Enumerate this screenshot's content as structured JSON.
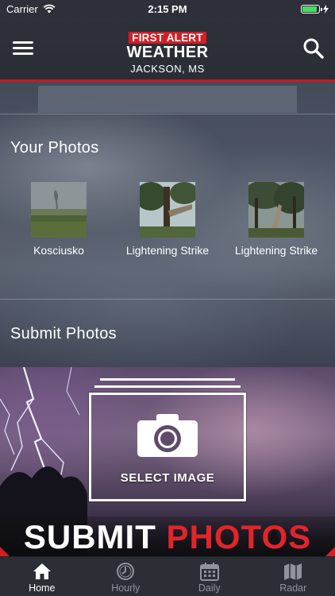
{
  "status_bar": {
    "carrier": "Carrier",
    "time": "2:15 PM",
    "battery_level": 0.9
  },
  "header": {
    "brand_line1": "FIRST ALERT",
    "brand_line2": "WEATHER",
    "location": "JACKSON, MS",
    "menu_icon": "hamburger-menu-icon",
    "search_icon": "search-icon"
  },
  "your_photos": {
    "title": "Your Photos",
    "items": [
      {
        "caption": "Kosciusko"
      },
      {
        "caption": "Lightening Strike"
      },
      {
        "caption": "Lightening Strike"
      }
    ]
  },
  "submit_photos": {
    "title": "Submit Photos",
    "select_label": "SELECT IMAGE",
    "banner_word1": "SUBMIT",
    "banner_word2": "PHOTOS"
  },
  "tab_bar": {
    "tabs": [
      {
        "label": "Home",
        "icon": "home-icon",
        "active": true
      },
      {
        "label": "Hourly",
        "icon": "clock-icon",
        "active": false
      },
      {
        "label": "Daily",
        "icon": "calendar-icon",
        "active": false
      },
      {
        "label": "Radar",
        "icon": "map-icon",
        "active": false
      }
    ]
  },
  "colors": {
    "brand_red": "#d21f26",
    "header_bg": "#2e3139",
    "tab_active": "#ffffff",
    "tab_inactive": "#8f939b"
  }
}
